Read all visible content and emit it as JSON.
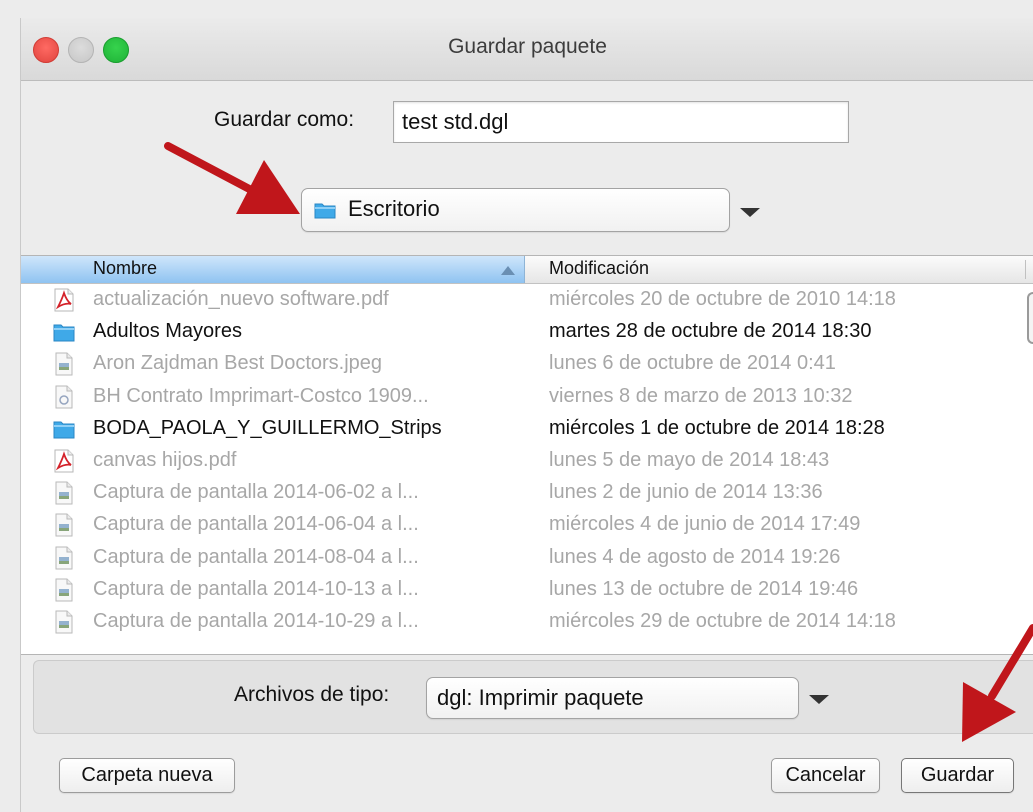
{
  "dialog": {
    "title": "Guardar paquete"
  },
  "save_as": {
    "label": "Guardar como:",
    "value": "test std.dgl"
  },
  "location": {
    "selected": "Escritorio",
    "icon": "folder-icon"
  },
  "file_list": {
    "columns": [
      "Nombre",
      "Modificación"
    ],
    "sort_column": "Nombre",
    "sort_order": "ascending",
    "rows": [
      {
        "name": "actualización_nuevo software.pdf",
        "modified": "miércoles 20 de octubre de 2010 14:18",
        "icon": "pdf-file-icon",
        "enabled": false
      },
      {
        "name": "Adultos Mayores",
        "modified": "martes 28 de octubre de 2014 18:30",
        "icon": "folder-icon",
        "enabled": true
      },
      {
        "name": "Aron Zajdman Best Doctors.jpeg",
        "modified": "lunes 6 de octubre de 2014 0:41",
        "icon": "image-file-icon",
        "enabled": false
      },
      {
        "name": "BH Contrato Imprimart-Costco 1909...",
        "modified": "viernes 8 de marzo de 2013 10:32",
        "icon": "document-file-icon",
        "enabled": false
      },
      {
        "name": "BODA_PAOLA_Y_GUILLERMO_Strips",
        "modified": "miércoles 1 de octubre de 2014 18:28",
        "icon": "folder-icon",
        "enabled": true
      },
      {
        "name": "canvas hijos.pdf",
        "modified": "lunes 5 de mayo de 2014 18:43",
        "icon": "pdf-file-icon",
        "enabled": false
      },
      {
        "name": "Captura de pantalla 2014-06-02 a l...",
        "modified": "lunes 2 de junio de 2014 13:36",
        "icon": "image-file-icon",
        "enabled": false
      },
      {
        "name": "Captura de pantalla 2014-06-04 a l...",
        "modified": "miércoles 4 de junio de 2014 17:49",
        "icon": "image-file-icon",
        "enabled": false
      },
      {
        "name": "Captura de pantalla 2014-08-04 a l...",
        "modified": "lunes 4 de agosto de 2014 19:26",
        "icon": "image-file-icon",
        "enabled": false
      },
      {
        "name": "Captura de pantalla 2014-10-13 a l...",
        "modified": "lunes 13 de octubre de 2014 19:46",
        "icon": "image-file-icon",
        "enabled": false
      },
      {
        "name": "Captura de pantalla 2014-10-29 a l...",
        "modified": "miércoles 29 de octubre de 2014 14:18",
        "icon": "image-file-icon",
        "enabled": false
      }
    ]
  },
  "file_type": {
    "label": "Archivos de tipo:",
    "selected": "dgl:  Imprimir paquete"
  },
  "buttons": {
    "new_folder": "Carpeta nueva",
    "cancel": "Cancelar",
    "save": "Guardar"
  },
  "colors": {
    "annotation_arrow": "#c0161b",
    "header_selected": "#8fc3f1",
    "folder": "#3fa9e8",
    "pdf": "#d4222a"
  }
}
